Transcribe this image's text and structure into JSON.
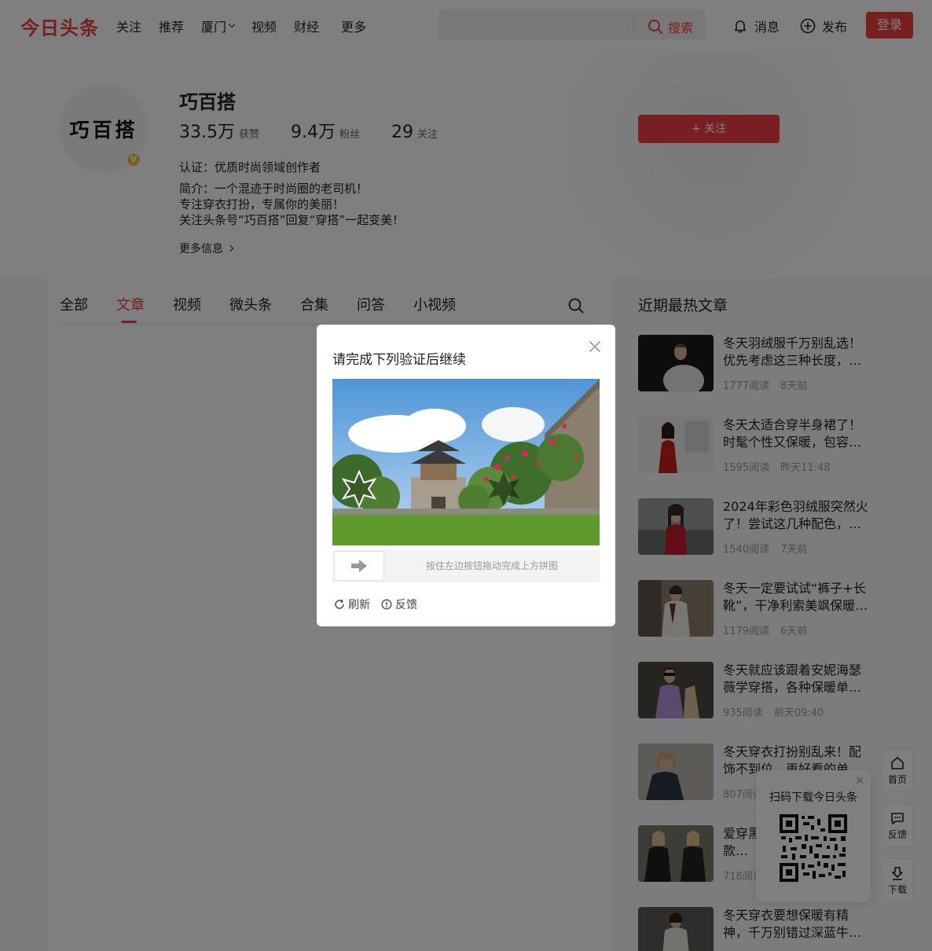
{
  "header": {
    "logo": "今日头条",
    "nav": [
      {
        "label": "关注"
      },
      {
        "label": "推荐"
      },
      {
        "label": "厦门",
        "has_dropdown": true
      },
      {
        "label": "视频"
      },
      {
        "label": "财经"
      }
    ],
    "nav_more": "更多",
    "search": {
      "placeholder": "",
      "button": "搜索"
    },
    "messages": "消息",
    "publish": "发布",
    "login": "登录",
    "accent_color": "#f04142"
  },
  "profile": {
    "avatar_text": "巧百搭",
    "verified_badge": "V",
    "name": "巧百搭",
    "stats": [
      {
        "value": "33.5万",
        "label": "获赞"
      },
      {
        "value": "9.4万",
        "label": "粉丝"
      },
      {
        "value": "29",
        "label": "关注"
      }
    ],
    "follow_button": "+ 关注",
    "certification": "认证：优质时尚领域创作者",
    "intro_lines": [
      "简介：一个混迹于时尚圈的老司机！",
      "专注穿衣打扮，专属你的美丽！",
      "关注头条号“巧百搭”回复“穿搭”一起变美！"
    ],
    "more_info": "更多信息"
  },
  "tabs": [
    {
      "label": "全部",
      "active": false
    },
    {
      "label": "文章",
      "active": true
    },
    {
      "label": "视频",
      "active": false
    },
    {
      "label": "微头条",
      "active": false
    },
    {
      "label": "合集",
      "active": false
    },
    {
      "label": "问答",
      "active": false
    },
    {
      "label": "小视频",
      "active": false
    }
  ],
  "sidebar": {
    "title": "近期最热文章",
    "articles": [
      {
        "title": "冬天羽绒服千万别乱选！优先考虑这三种长度，…",
        "reads": "1777阅读",
        "time": "8天前"
      },
      {
        "title": "冬天太适合穿半身裙了！时髦个性又保暖，包容…",
        "reads": "1595阅读",
        "time": "昨天11:48"
      },
      {
        "title": "2024年彩色羽绒服突然火了！尝试这几种配色，…",
        "reads": "1540阅读",
        "time": "7天前"
      },
      {
        "title": "冬天一定要试试“裤子+长靴”，干净利索美飒保暖…",
        "reads": "1179阅读",
        "time": "6天前"
      },
      {
        "title": "冬天就应该跟着安妮海瑟薇学穿搭，各种保暖单…",
        "reads": "935阅读",
        "time": "前天09:40"
      },
      {
        "title": "冬天穿衣打扮别乱来！配饰不到位，再好看的单…",
        "reads": "807阅读",
        "time": ""
      },
      {
        "title": "爱穿黑色的女人注意了！款…",
        "reads": "718阅读",
        "time": ""
      },
      {
        "title": "冬天穿衣要想保暖有精神，千万别错过深蓝牛…",
        "reads": "",
        "time": ""
      }
    ]
  },
  "tools": [
    {
      "label": "首页",
      "icon": "home-icon"
    },
    {
      "label": "反馈",
      "icon": "feedback-icon"
    },
    {
      "label": "下载",
      "icon": "download-icon"
    }
  ],
  "qr_card": {
    "title": "扫码下载今日头条"
  },
  "captcha": {
    "title": "请完成下列验证后继续",
    "slider_hint": "按住左边按钮拖动完成上方拼图",
    "refresh": "刷新",
    "feedback": "反馈"
  }
}
